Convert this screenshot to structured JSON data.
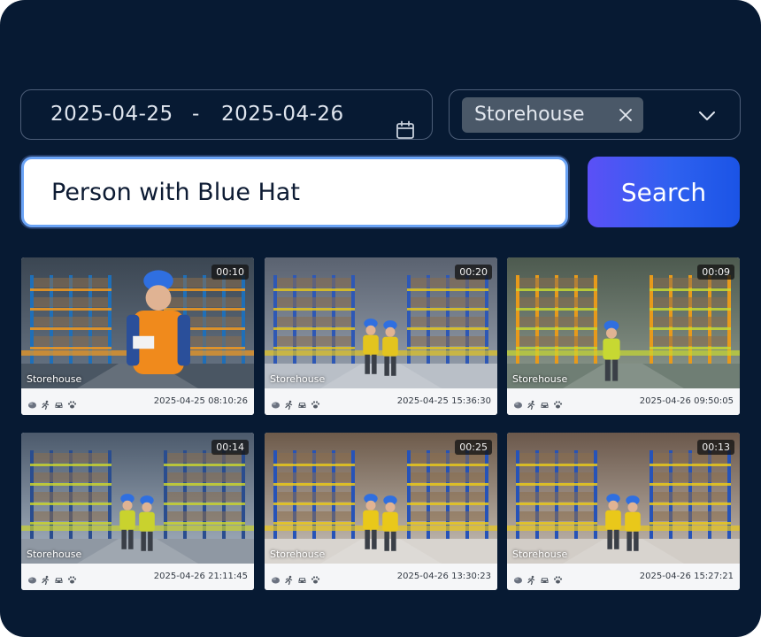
{
  "filters": {
    "date_start": "2025-04-25",
    "date_separator": "-",
    "date_end": "2025-04-26",
    "location_tag": "Storehouse"
  },
  "search": {
    "query": "Person with Blue Hat",
    "button_label": "Search"
  },
  "results": [
    {
      "duration": "00:10",
      "location": "Storehouse",
      "timestamp": "2025-04-25 08:10:26"
    },
    {
      "duration": "00:20",
      "location": "Storehouse",
      "timestamp": "2025-04-25 15:36:30"
    },
    {
      "duration": "00:09",
      "location": "Storehouse",
      "timestamp": "2025-04-26 09:50:05"
    },
    {
      "duration": "00:14",
      "location": "Storehouse",
      "timestamp": "2025-04-26 21:11:45"
    },
    {
      "duration": "00:25",
      "location": "Storehouse",
      "timestamp": "2025-04-26 13:30:23"
    },
    {
      "duration": "00:13",
      "location": "Storehouse",
      "timestamp": "2025-04-26 15:27:21"
    }
  ],
  "detection_icons": [
    "object-icon",
    "person-running-icon",
    "vehicle-icon",
    "animal-paw-icon"
  ],
  "colors": {
    "background": "#071a33",
    "accent_gradient_start": "#5b50f6",
    "accent_gradient_end": "#1b54e6",
    "input_focus_border": "#6aa3f5"
  }
}
